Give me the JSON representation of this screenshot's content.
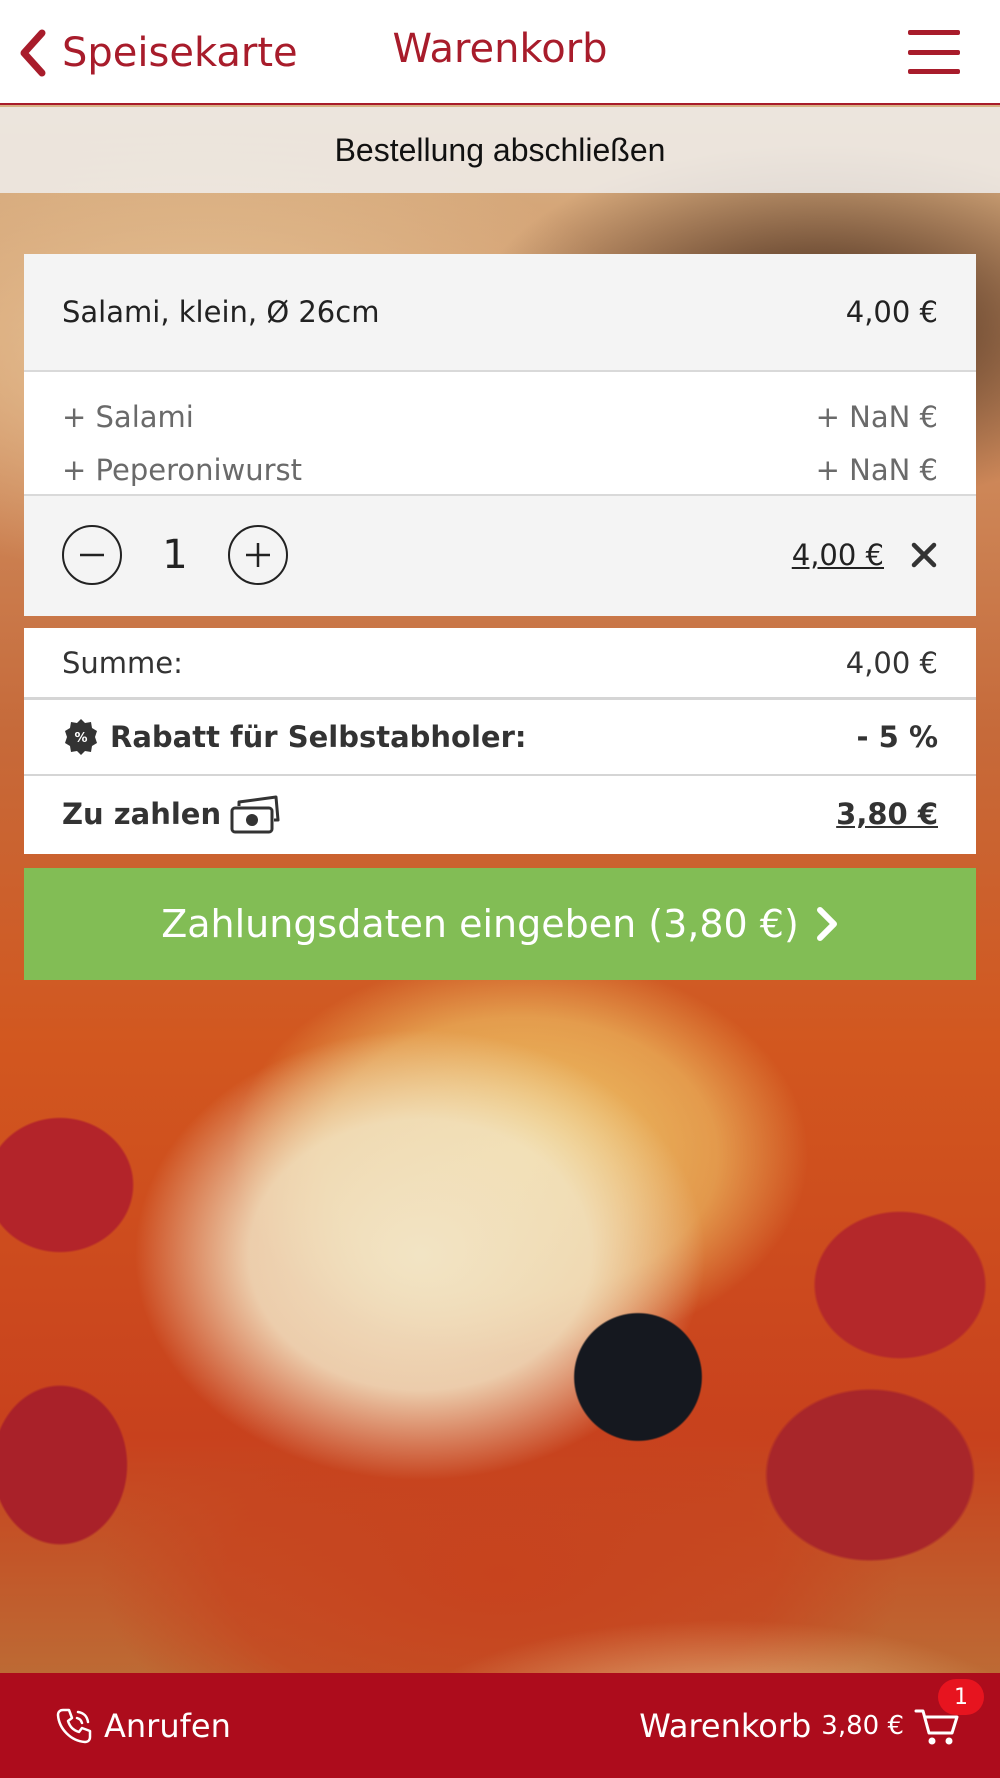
{
  "header": {
    "back_label": "Speisekarte",
    "title": "Warenkorb"
  },
  "subheader": {
    "title": "Bestellung abschließen"
  },
  "cart_item": {
    "name": "Salami, klein, Ø 26cm",
    "base_price": "4,00 €",
    "extras": [
      {
        "name": "+ Salami",
        "price": "+ NaN €"
      },
      {
        "name": "+ Peperoniwurst",
        "price": "+ NaN €"
      }
    ],
    "quantity": "1",
    "line_total": "4,00 €"
  },
  "totals": {
    "sum_label": "Summe:",
    "sum_value": "4,00 €",
    "discount_label": "Rabatt für Selbstabholer:",
    "discount_value": "- 5 %",
    "pay_label": "Zu zahlen",
    "pay_value": "3,80 €"
  },
  "pay_button": {
    "label": "Zahlungsdaten eingeben (3,80 €)"
  },
  "footer": {
    "call_label": "Anrufen",
    "cart_label": "Warenkorb",
    "cart_total": "3,80 €",
    "cart_count": "1"
  },
  "colors": {
    "brand": "#a81c2b",
    "footer": "#ad0c1c",
    "pay_button": "#82bd55",
    "badge": "#e7141f"
  },
  "icons": [
    "chevron-left-icon",
    "hamburger-menu-icon",
    "minus-circle-icon",
    "plus-circle-icon",
    "close-icon",
    "percent-badge-icon",
    "money-icon",
    "chevron-right-icon",
    "phone-icon",
    "shopping-cart-icon"
  ]
}
